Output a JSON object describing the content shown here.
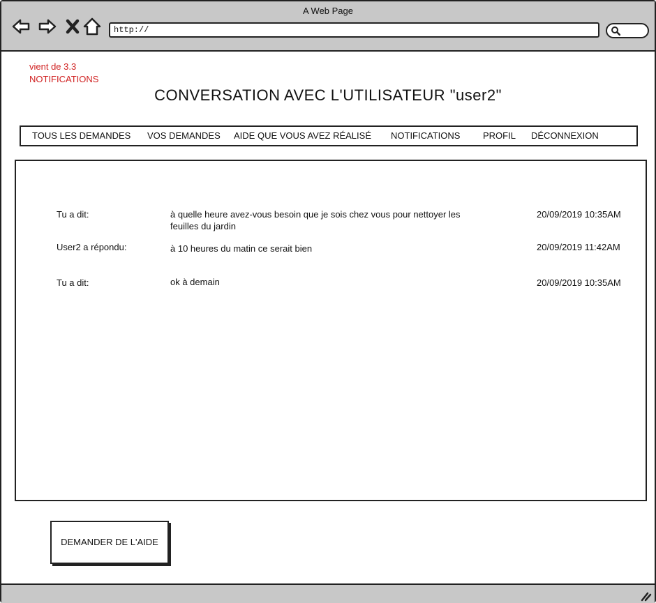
{
  "browser": {
    "window_title": "A Web Page",
    "url": "http://"
  },
  "note": {
    "line1": "vient de 3.3",
    "line2": "NOTIFICATIONS",
    "color": "#d02020"
  },
  "page": {
    "title": "CONVERSATION AVEC L'UTILISATEUR \"user2\""
  },
  "menu": {
    "items": [
      {
        "label": "TOUS LES DEMANDES"
      },
      {
        "label": "VOS DEMANDES"
      },
      {
        "label": "AIDE QUE VOUS AVEZ RÉALISÉ"
      },
      {
        "label": "NOTIFICATIONS"
      },
      {
        "label": "PROFIL"
      },
      {
        "label": "DÉCONNEXION"
      }
    ]
  },
  "conversation": {
    "messages": [
      {
        "author": "Tu a dit:",
        "text": "à quelle heure avez-vous besoin que je sois chez vous pour nettoyer les feuilles du jardin",
        "time": "20/09/2019 10:35AM"
      },
      {
        "author": "User2 a répondu:",
        "text": "à 10 heures du matin ce serait bien",
        "time": "20/09/2019 11:42AM"
      },
      {
        "author": "Tu a dit:",
        "text": "ok à demain",
        "time": "20/09/2019 10:35AM"
      }
    ]
  },
  "actions": {
    "help_button": "DEMANDER DE L'AIDE"
  },
  "icons": [
    "back-arrow-icon",
    "forward-arrow-icon",
    "close-icon",
    "home-icon",
    "search-icon",
    "resize-grip-icon"
  ]
}
